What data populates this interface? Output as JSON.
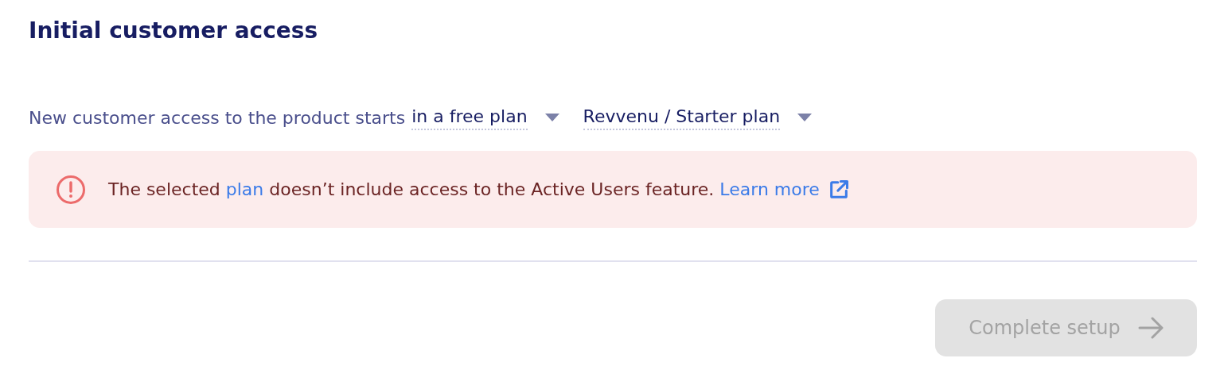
{
  "title": "Initial customer access",
  "access": {
    "label": "New customer access to the product starts",
    "dropdowns": [
      {
        "value": "in a free plan"
      },
      {
        "value": "Revvenu / Starter plan"
      }
    ]
  },
  "alert": {
    "text_before": "The selected ",
    "link": "plan",
    "text_after": " doesn’t include access to the Active Users feature.",
    "learn_more": "Learn more"
  },
  "button": {
    "label": "Complete setup",
    "disabled": true
  }
}
